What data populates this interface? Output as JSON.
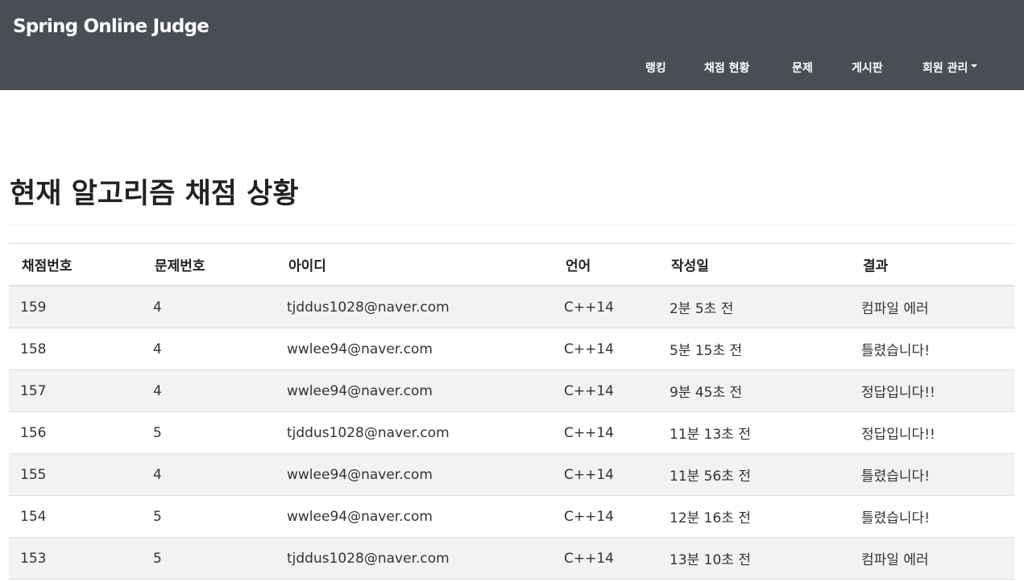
{
  "navbar": {
    "brand": "Spring Online Judge",
    "items": [
      {
        "label": "랭킹"
      },
      {
        "label": "채점 현황"
      },
      {
        "label": "문제"
      },
      {
        "label": "게시판"
      },
      {
        "label": "회원 관리",
        "dropdown": true
      }
    ]
  },
  "main": {
    "title": "현재 알고리즘 채점 상황",
    "table": {
      "headers": [
        "채점번호",
        "문제번호",
        "아이디",
        "언어",
        "작성일",
        "결과"
      ],
      "rows": [
        [
          "159",
          "4",
          "tjddus1028@naver.com",
          "C++14",
          "2분 5초 전",
          "컴파일 에러"
        ],
        [
          "158",
          "4",
          "wwlee94@naver.com",
          "C++14",
          "5분 15초 전",
          "틀렸습니다!"
        ],
        [
          "157",
          "4",
          "wwlee94@naver.com",
          "C++14",
          "9분 45초 전",
          "정답입니다!!"
        ],
        [
          "156",
          "5",
          "tjddus1028@naver.com",
          "C++14",
          "11분 13초 전",
          "정답입니다!!"
        ],
        [
          "155",
          "4",
          "wwlee94@naver.com",
          "C++14",
          "11분 56초 전",
          "틀렸습니다!"
        ],
        [
          "154",
          "5",
          "wwlee94@naver.com",
          "C++14",
          "12분 16초 전",
          "틀렸습니다!"
        ],
        [
          "153",
          "5",
          "tjddus1028@naver.com",
          "C++14",
          "13분 10초 전",
          "컴파일 에러"
        ]
      ]
    }
  },
  "colors": {
    "navbar_bg": "#484e54",
    "row_stripe": "#f2f2f2",
    "border": "#dddddd"
  }
}
